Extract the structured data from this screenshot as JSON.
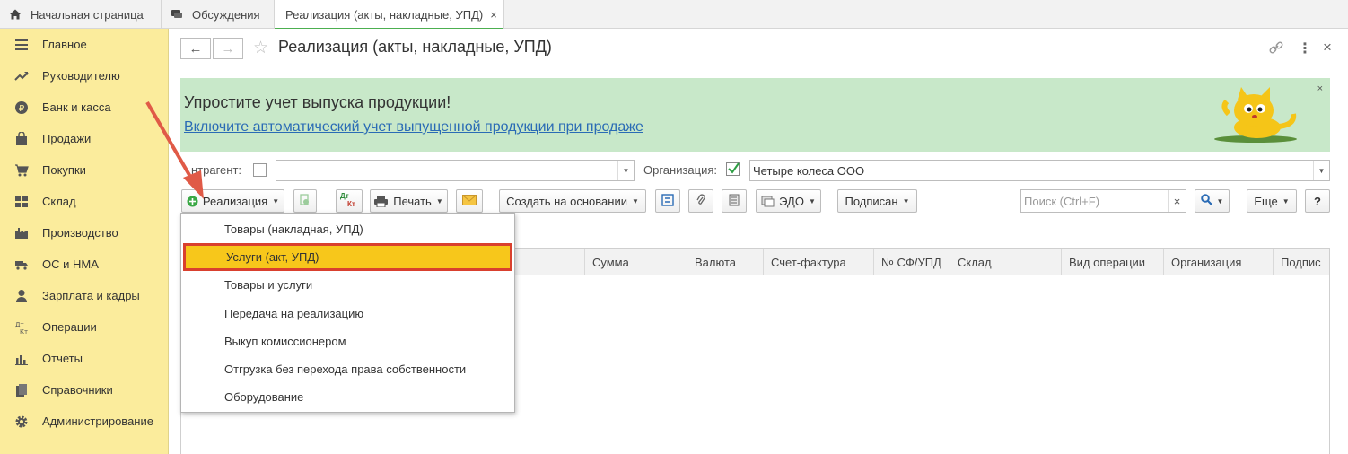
{
  "tabs": [
    {
      "label": "Начальная страница",
      "icon": "home-icon"
    },
    {
      "label": "Обсуждения",
      "icon": "chat-icon"
    },
    {
      "label": "Реализация (акты, накладные, УПД)",
      "close": "×"
    }
  ],
  "sidebar": {
    "items": [
      {
        "label": "Главное",
        "icon": "menu-lines-icon"
      },
      {
        "label": "Руководителю",
        "icon": "trend-icon"
      },
      {
        "label": "Банк и касса",
        "icon": "ruble-coin-icon"
      },
      {
        "label": "Продажи",
        "icon": "bag-icon"
      },
      {
        "label": "Покупки",
        "icon": "cart-icon"
      },
      {
        "label": "Склад",
        "icon": "warehouse-icon"
      },
      {
        "label": "Производство",
        "icon": "factory-icon"
      },
      {
        "label": "ОС и НМА",
        "icon": "truck-icon"
      },
      {
        "label": "Зарплата и кадры",
        "icon": "person-icon"
      },
      {
        "label": "Операции",
        "icon": "dt-kt-icon"
      },
      {
        "label": "Отчеты",
        "icon": "bar-chart-icon"
      },
      {
        "label": "Справочники",
        "icon": "books-icon"
      },
      {
        "label": "Администрирование",
        "icon": "gear-icon"
      }
    ]
  },
  "header": {
    "title": "Реализация (акты, накладные, УПД)"
  },
  "banner": {
    "title": "Упростите учет выпуска продукции!",
    "link": "Включите автоматический учет выпущенной продукции при продаже",
    "close": "×"
  },
  "filters": {
    "counterparty_label": "нтрагент:",
    "counterparty_value": "",
    "organization_label": "Организация:",
    "organization_value": "Четыре колеса ООО"
  },
  "toolbar": {
    "realization": "Реализация",
    "dtkt_top": "Дт",
    "dtkt_bottom": "Кт",
    "print": "Печать",
    "create_based": "Создать на основании",
    "edo": "ЭДО",
    "signed": "Подписан",
    "search_placeholder": "Поиск (Ctrl+F)",
    "search_clear": "×",
    "more": "Еще",
    "help": "?"
  },
  "table": {
    "columns": [
      "Сумма",
      "Валюта",
      "Счет-фактура",
      "№ СФ/УПД",
      "Склад",
      "Вид операции",
      "Организация",
      "Подпис"
    ]
  },
  "menu": {
    "items": [
      "Товары (накладная, УПД)",
      "Услуги (акт, УПД)",
      "Товары и услуги",
      "Передача на реализацию",
      "Выкуп комиссионером",
      "Отгрузка без перехода права собственности",
      "Оборудование"
    ]
  },
  "colors": {
    "sidebar": "#fbec9c",
    "banner": "#c8e8c9",
    "highlight": "#f7c71b",
    "highlight_border": "#d9402e",
    "link": "#2a6bb5",
    "accent_green": "#4caf50"
  }
}
